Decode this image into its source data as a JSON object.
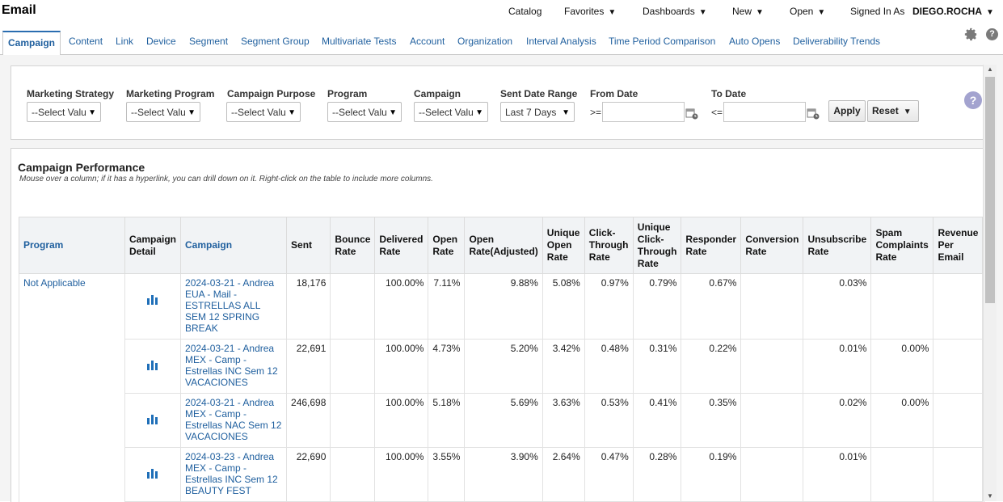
{
  "app": {
    "title": "Email"
  },
  "topnav": {
    "catalog": "Catalog",
    "favorites": "Favorites",
    "dashboards": "Dashboards",
    "new": "New",
    "open": "Open",
    "signed_in_as": "Signed In As",
    "user": "DIEGO.ROCHA"
  },
  "tabs": [
    "Campaign",
    "Content",
    "Link",
    "Device",
    "Segment",
    "Segment Group",
    "Multivariate Tests",
    "Account",
    "Organization",
    "Interval Analysis",
    "Time Period Comparison",
    "Auto Opens",
    "Deliverability Trends"
  ],
  "filters": {
    "marketing_strategy": {
      "label": "Marketing Strategy",
      "value": "--Select Valu"
    },
    "marketing_program": {
      "label": "Marketing Program",
      "value": "--Select Valu"
    },
    "campaign_purpose": {
      "label": "Campaign Purpose",
      "value": "--Select Valu"
    },
    "program": {
      "label": "Program",
      "value": "--Select Valu"
    },
    "campaign": {
      "label": "Campaign",
      "value": "--Select Valu"
    },
    "sent_date_range": {
      "label": "Sent Date Range",
      "value": "Last 7 Days"
    },
    "from_date": {
      "label": "From Date",
      "operator": ">=",
      "value": ""
    },
    "to_date": {
      "label": "To Date",
      "operator": "<=",
      "value": ""
    },
    "apply": "Apply",
    "reset": "Reset",
    "help": "?"
  },
  "report": {
    "title": "Campaign Performance",
    "subtitle": "Mouse over a column; if it has a hyperlink, you can drill down on it. Right-click on the table to include more columns.",
    "columns": [
      "Program",
      "Campaign Detail",
      "Campaign",
      "Sent",
      "Bounce Rate",
      "Delivered Rate",
      "Open Rate",
      "Open Rate(Adjusted)",
      "Unique Open Rate",
      "Click-Through Rate",
      "Unique Click-Through Rate",
      "Responder Rate",
      "Conversion Rate",
      "Unsubscribe Rate",
      "Spam Complaints Rate",
      "Revenue Per Email"
    ],
    "program": "Not Applicable",
    "rows": [
      {
        "campaign": "2024-03-21 - Andrea EUA - Mail - ESTRELLAS ALL SEM 12 SPRING BREAK",
        "sent": "18,176",
        "bounce": "",
        "delivered": "100.00%",
        "open": "7.11%",
        "open_adj": "9.88%",
        "uopen": "5.08%",
        "ctr": "0.97%",
        "uctr": "0.79%",
        "responder": "0.67%",
        "conversion": "",
        "unsub": "0.03%",
        "spam": "",
        "revenue": ""
      },
      {
        "campaign": "2024-03-21 - Andrea MEX - Camp - Estrellas INC Sem 12 VACACIONES",
        "sent": "22,691",
        "bounce": "",
        "delivered": "100.00%",
        "open": "4.73%",
        "open_adj": "5.20%",
        "uopen": "3.42%",
        "ctr": "0.48%",
        "uctr": "0.31%",
        "responder": "0.22%",
        "conversion": "",
        "unsub": "0.01%",
        "spam": "0.00%",
        "revenue": ""
      },
      {
        "campaign": "2024-03-21 - Andrea MEX - Camp - Estrellas NAC Sem 12 VACACIONES",
        "sent": "246,698",
        "bounce": "",
        "delivered": "100.00%",
        "open": "5.18%",
        "open_adj": "5.69%",
        "uopen": "3.63%",
        "ctr": "0.53%",
        "uctr": "0.41%",
        "responder": "0.35%",
        "conversion": "",
        "unsub": "0.02%",
        "spam": "0.00%",
        "revenue": ""
      },
      {
        "campaign": "2024-03-23 - Andrea MEX - Camp - Estrellas INC Sem 12 BEAUTY FEST",
        "sent": "22,690",
        "bounce": "",
        "delivered": "100.00%",
        "open": "3.55%",
        "open_adj": "3.90%",
        "uopen": "2.64%",
        "ctr": "0.47%",
        "uctr": "0.28%",
        "responder": "0.19%",
        "conversion": "",
        "unsub": "0.01%",
        "spam": "",
        "revenue": ""
      }
    ]
  }
}
